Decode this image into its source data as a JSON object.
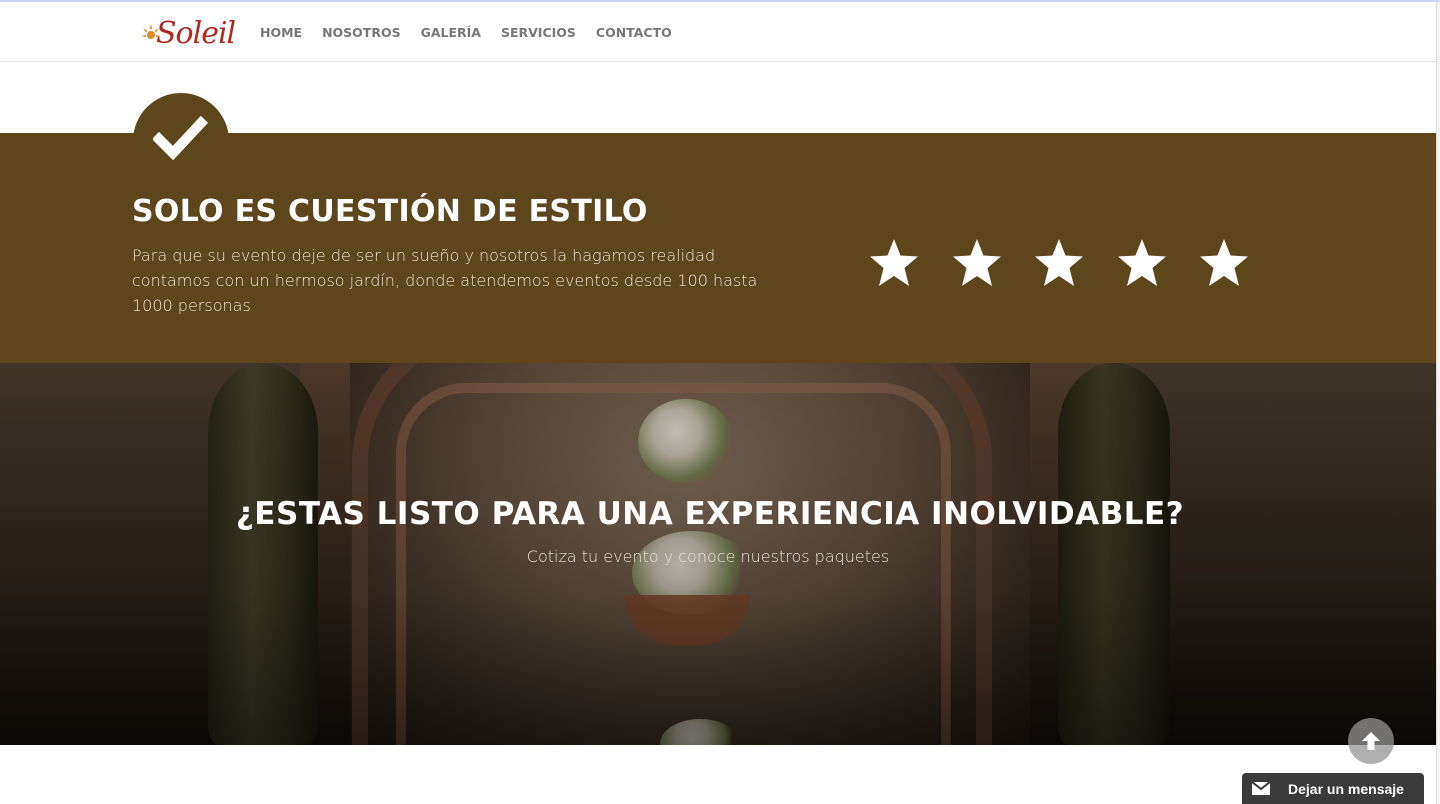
{
  "brand": {
    "name": "Soleil",
    "accent": "#b0281e"
  },
  "nav": {
    "items": [
      {
        "label": "HOME"
      },
      {
        "label": "NOSOTROS"
      },
      {
        "label": "GALERÍA"
      },
      {
        "label": "SERVICIOS"
      },
      {
        "label": "CONTACTO"
      }
    ]
  },
  "feature": {
    "icon": "check-icon",
    "title": "SOLO ES CUESTIÓN DE ESTILO",
    "description": "Para que su evento deje de ser un sueño y nosotros la hagamos realidad contamos con un hermoso jardín, donde atendemos eventos desde 100 hasta 1000 personas",
    "rating": {
      "stars_shown": 5,
      "icon": "star-icon"
    },
    "background_color": "#5d451c"
  },
  "cta": {
    "title": "¿ESTAS LISTO PARA UNA EXPERIENCIA INOLVIDABLE?",
    "subtitle": "Cotiza tu evento y conoce nuestros paquetes"
  },
  "floating": {
    "back_to_top_icon": "arrow-up-icon",
    "chat_label": "Dejar un mensaje",
    "chat_icon": "envelope-icon"
  }
}
